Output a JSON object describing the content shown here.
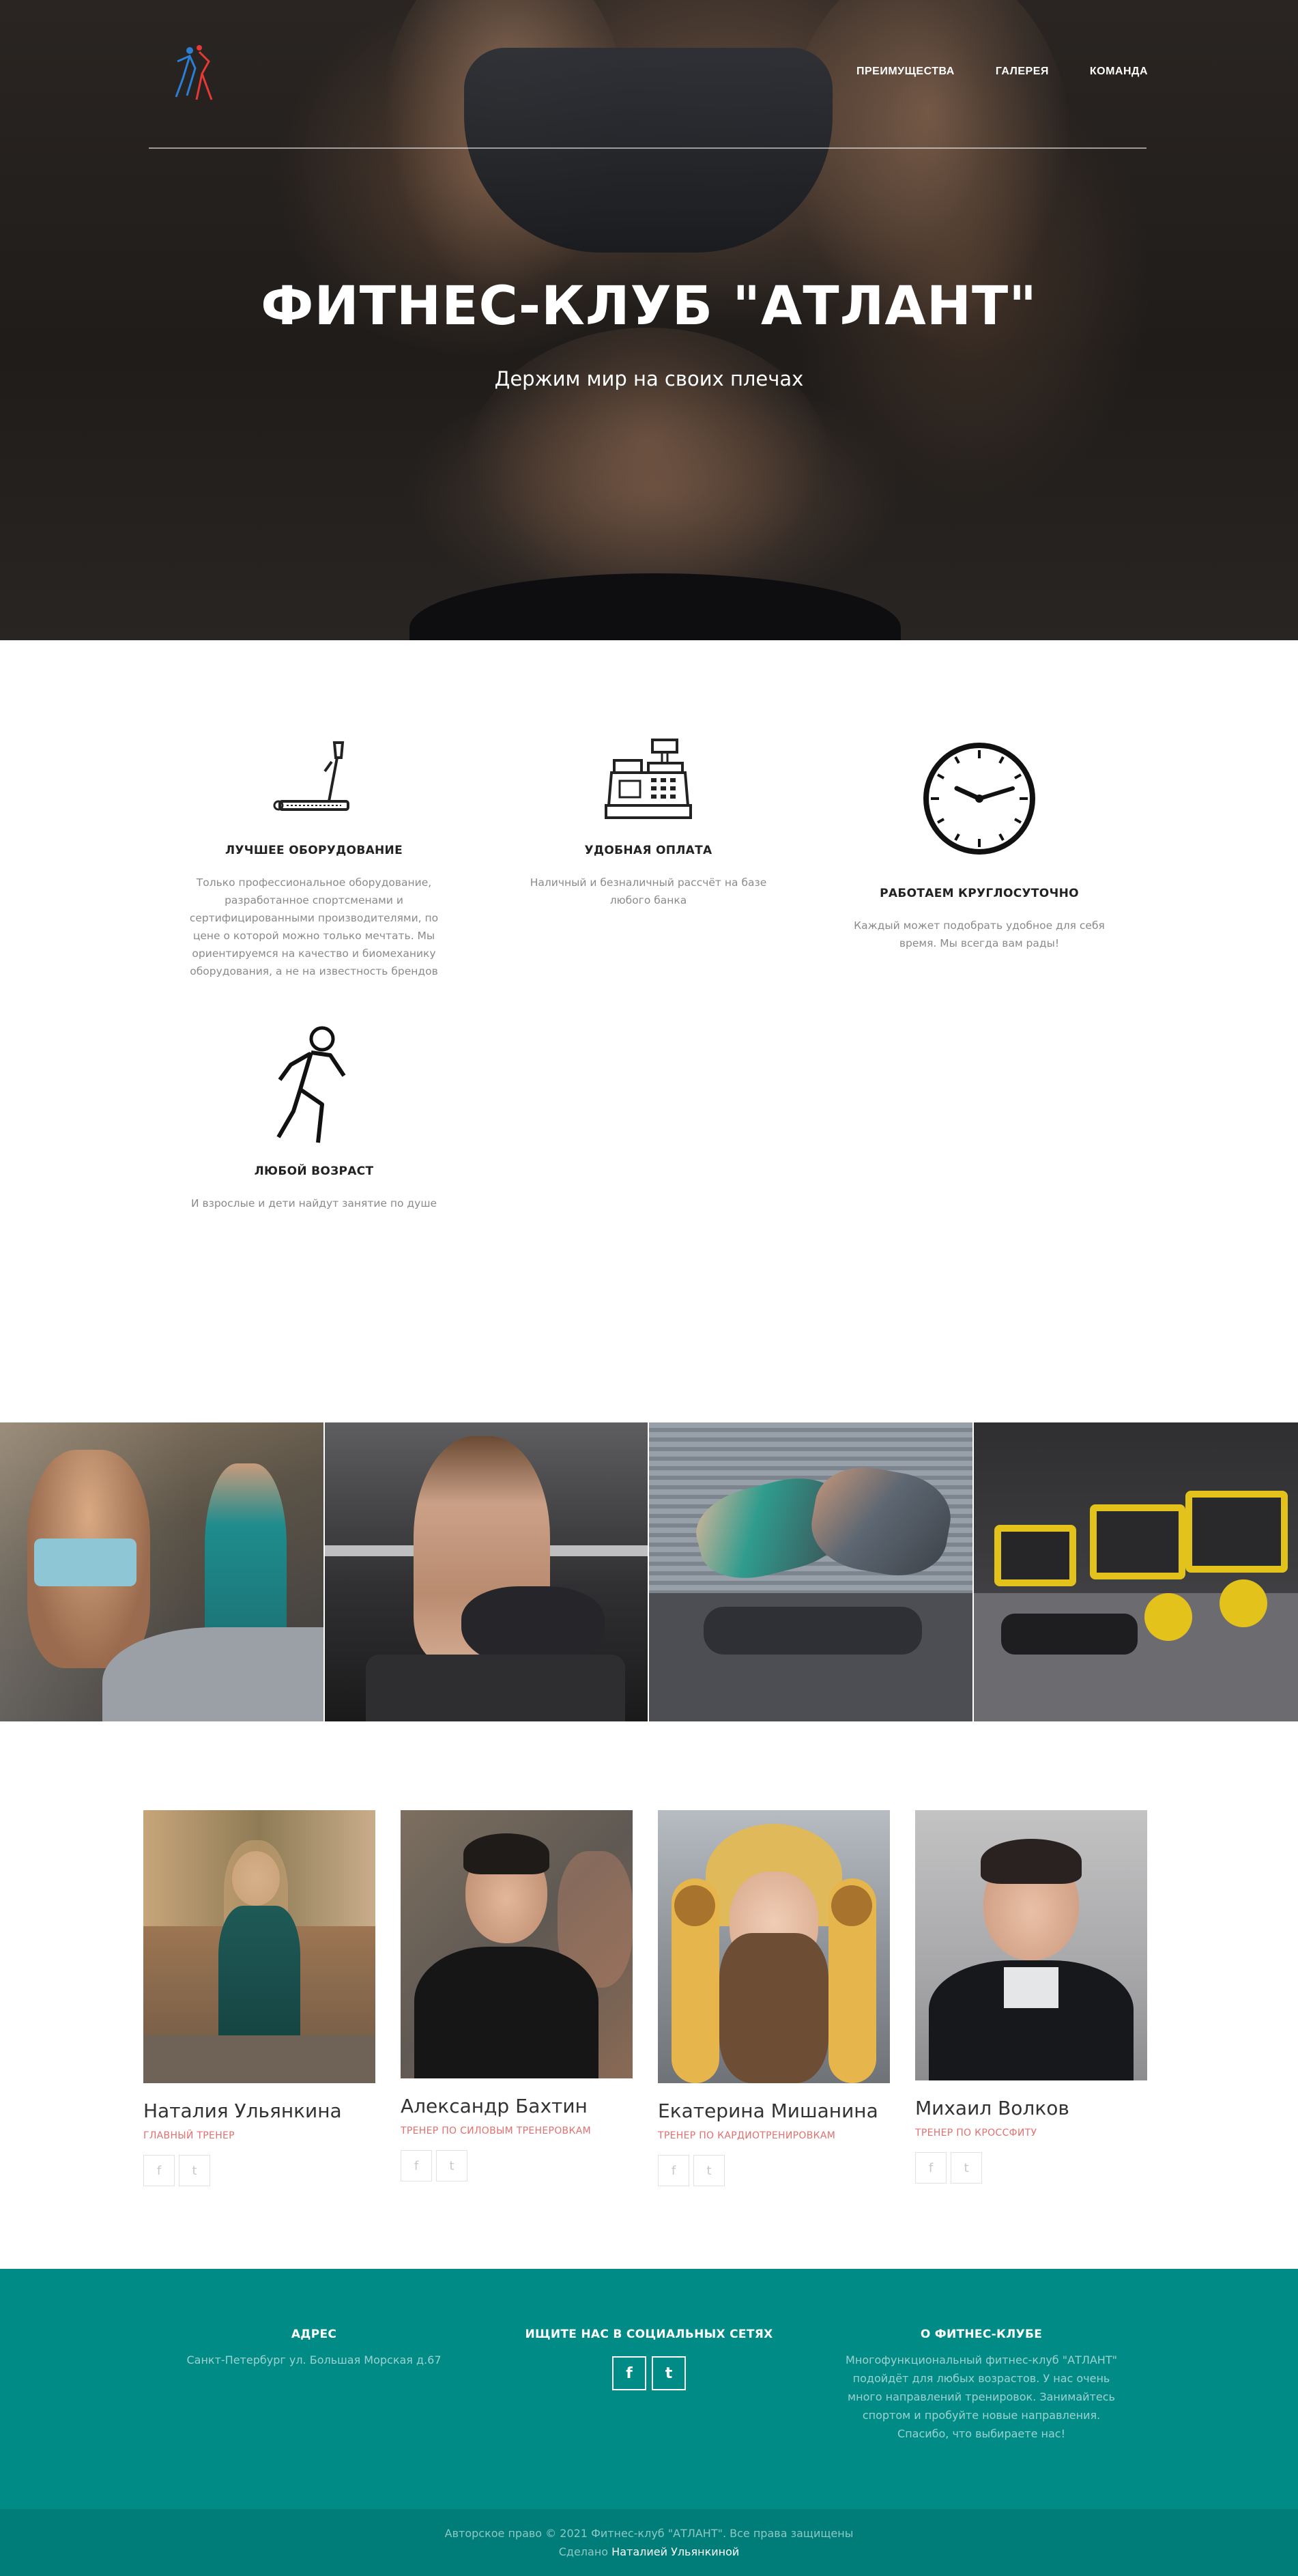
{
  "nav": {
    "items": [
      {
        "label": "ПРЕИМУЩЕСТВА"
      },
      {
        "label": "ГАЛЕРЕЯ"
      },
      {
        "label": "КОМАНДА"
      }
    ]
  },
  "hero": {
    "title": "ФИТНЕС-КЛУБ \"АТЛАНТ\"",
    "subtitle": "Держим мир на своих плечах"
  },
  "features": [
    {
      "icon": "treadmill-icon",
      "title": "ЛУЧШЕЕ ОБОРУДОВАНИЕ",
      "text": "Только профессиональное оборудование, разработанное спортсменами и сертифицированными производителями, по цене о которой можно только мечтать. Мы ориентируемся на качество и биомеханику оборудования, а не на известность брендов"
    },
    {
      "icon": "cash-register-icon",
      "title": "УДОБНАЯ ОПЛАТА",
      "text": "Наличный и безналичный рассчёт на базе любого банка"
    },
    {
      "icon": "clock-icon",
      "title": "РАБОТАЕМ КРУГЛОСУТОЧНО",
      "text": "Каждый может подобрать удобное для себя время. Мы всегда вам рады!"
    },
    {
      "icon": "running-person-icon",
      "title": "ЛЮБОЙ ВОЗРАСТ",
      "text": "И взрослые и дети найдут занятие по душе"
    }
  ],
  "team": [
    {
      "name": "Наталия Ульянкина",
      "role": "ГЛАВНЫЙ ТРЕНЕР",
      "social": [
        "f",
        "t"
      ]
    },
    {
      "name": "Александр Бахтин",
      "role": "ТРЕНЕР ПО СИЛОВЫМ ТРЕНЕРОВКАМ",
      "social": [
        "f",
        "t"
      ]
    },
    {
      "name": "Екатерина Мишанина",
      "role": "ТРЕНЕР ПО КАРДИОТРЕНИРОВКАМ",
      "social": [
        "f",
        "t"
      ]
    },
    {
      "name": "Михаил Волков",
      "role": "ТРЕНЕР ПО КРОССФИТУ",
      "social": [
        "f",
        "t"
      ]
    }
  ],
  "footer": {
    "address_title": "АДРЕС",
    "address_text": "Санкт-Петербург ул. Большая Морская д.67",
    "social_title": "ИЩИТЕ НАС В СОЦИАЛЬНЫХ СЕТЯХ",
    "social": [
      "f",
      "t"
    ],
    "about_title": "О ФИТНЕС-КЛУБЕ",
    "about_text": "Многофункциональный фитнес-клуб \"АТЛАНТ\" подойдёт для любых возрастов. У нас очень много направлений тренировок. Занимайтесь спортом и пробуйте новые направления. Спасибо, что выбираете нас!"
  },
  "copyright": {
    "line1": "Авторское право © 2021 Фитнес-клуб \"АТЛАНТ\". Все права защищены",
    "made_by": "Сделано",
    "author": "Наталией Ульянкиной"
  },
  "colors": {
    "footer_bg": "#008b87",
    "copyright_bg": "#007d79",
    "role_accent": "#e46f6f"
  }
}
